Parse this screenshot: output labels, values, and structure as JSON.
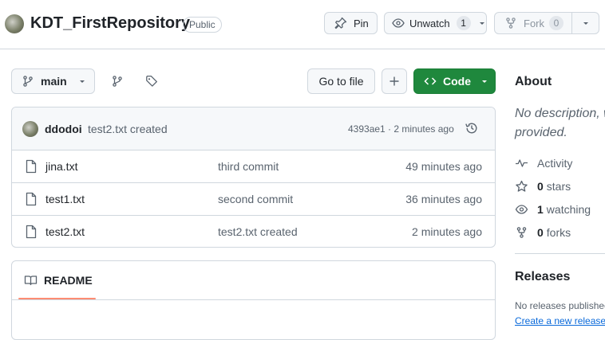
{
  "repo": {
    "name": "KDT_FirstRepository",
    "visibility": "Public"
  },
  "actions": {
    "pin_label": "Pin",
    "unwatch_label": "Unwatch",
    "watch_count": "1",
    "fork_label": "Fork",
    "fork_count": "0"
  },
  "toolbar": {
    "branch": "main",
    "go_to_file": "Go to file",
    "code_label": "Code"
  },
  "latest_commit": {
    "author": "ddodoi",
    "message": "test2.txt created",
    "hash_time": "4393ae1 · 2 minutes ago"
  },
  "files": [
    {
      "name": "jina.txt",
      "message": "third commit",
      "time": "49 minutes ago"
    },
    {
      "name": "test1.txt",
      "message": "second commit",
      "time": "36 minutes ago"
    },
    {
      "name": "test2.txt",
      "message": "test2.txt created",
      "time": "2 minutes ago"
    }
  ],
  "readme": {
    "tab_label": "README"
  },
  "about": {
    "heading": "About",
    "description_line1": "No description, w",
    "description_line2": "provided.",
    "activity": "Activity",
    "stars_count": "0",
    "stars_label": "stars",
    "watching_count": "1",
    "watching_label": "watching",
    "forks_count": "0",
    "forks_label": "forks"
  },
  "releases": {
    "heading": "Releases",
    "none_text": "No releases published",
    "create_link": "Create a new release"
  },
  "colors": {
    "code_button": "#1f883d",
    "border": "#d0d7de",
    "muted_text": "#59636e",
    "link": "#0969da",
    "readme_tab_underline": "#fd8c73"
  }
}
